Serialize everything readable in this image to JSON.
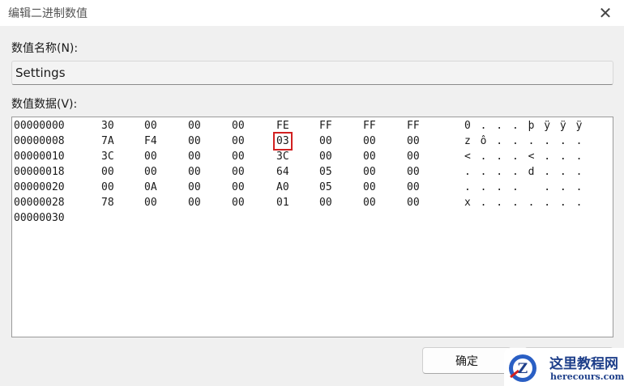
{
  "window": {
    "title": "编辑二进制数值",
    "close_glyph": "✕"
  },
  "name_section": {
    "label": "数值名称(N):",
    "value": "Settings"
  },
  "data_section": {
    "label": "数值数据(V):",
    "rows": [
      {
        "addr": "00000000",
        "bytes": [
          "30",
          "00",
          "00",
          "00",
          "FE",
          "FF",
          "FF",
          "FF"
        ],
        "ascii": "0 . . . þ ÿ ÿ ÿ"
      },
      {
        "addr": "00000008",
        "bytes": [
          "7A",
          "F4",
          "00",
          "00",
          "03",
          "00",
          "00",
          "00"
        ],
        "ascii": "z ô . . . . . ."
      },
      {
        "addr": "00000010",
        "bytes": [
          "3C",
          "00",
          "00",
          "00",
          "3C",
          "00",
          "00",
          "00"
        ],
        "ascii": "< . . . < . . ."
      },
      {
        "addr": "00000018",
        "bytes": [
          "00",
          "00",
          "00",
          "00",
          "64",
          "05",
          "00",
          "00"
        ],
        "ascii": ". . . . d . . ."
      },
      {
        "addr": "00000020",
        "bytes": [
          "00",
          "0A",
          "00",
          "00",
          "A0",
          "05",
          "00",
          "00"
        ],
        "ascii": ". . . .   . . ."
      },
      {
        "addr": "00000028",
        "bytes": [
          "78",
          "00",
          "00",
          "00",
          "01",
          "00",
          "00",
          "00"
        ],
        "ascii": "x . . . . . . ."
      },
      {
        "addr": "00000030",
        "bytes": [
          "",
          "",
          "",
          "",
          "",
          "",
          "",
          ""
        ],
        "ascii": ""
      }
    ],
    "highlighted": {
      "row": 1,
      "byte": 4,
      "color": "#d22020"
    }
  },
  "buttons": {
    "ok": "确定"
  },
  "watermark": {
    "line1": "这里教程网",
    "line2": "herecours.com",
    "letter": "Z"
  }
}
